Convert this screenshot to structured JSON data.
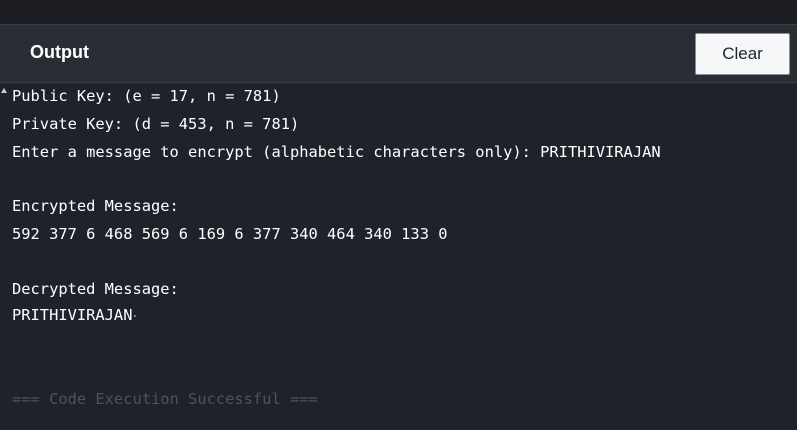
{
  "header": {
    "title": "Output",
    "clear_label": "Clear"
  },
  "console": {
    "lines": [
      "Public Key: (e = 17, n = 781)",
      "Private Key: (d = 453, n = 781)",
      "Enter a message to encrypt (alphabetic characters only): PRITHIVIRAJAN",
      "Encrypted Message:",
      "592 377 6 468 569 6 169 6 377 340 464 340 133 0",
      "Decrypted Message:",
      "PRITHIVIRAJAN",
      "=== Code Execution Successful ==="
    ]
  },
  "colors": {
    "background": "#1f222a",
    "header_background": "#2a2d35",
    "text": "#ffffff",
    "muted_text": "#4e525c"
  }
}
